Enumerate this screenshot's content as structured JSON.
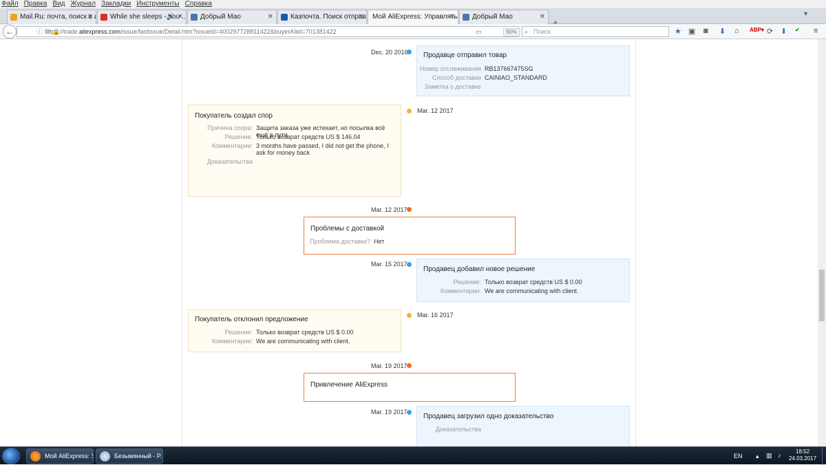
{
  "menu": [
    "Файл",
    "Правка",
    "Вид",
    "Журнал",
    "Закладки",
    "Инструменты",
    "Справка"
  ],
  "tabs": [
    {
      "label": "Mail.Ru: почта, поиск в ин...",
      "color": "#f0a020"
    },
    {
      "label": "While she sleeps - You ...",
      "color": "#d93025"
    },
    {
      "label": "Добрый Мао",
      "color": "#4a76a8"
    },
    {
      "label": "Казпочта. Поиск отправл...",
      "color": "#1e5aa8"
    },
    {
      "label": "Мой AliExpress: Управлять зак...",
      "color": "#e64a19"
    },
    {
      "label": "Добрый Мао",
      "color": "#4a76a8"
    }
  ],
  "address": {
    "prefix": "https://trade.",
    "domain": "aliexpress.com",
    "path": "/issue/fastissue/Detail.htm?issueId=400297728811422&buyerAliid=701381422",
    "zoom": "90%",
    "search_placeholder": "Поиск"
  },
  "timeline": [
    {
      "date": "Dec. 20 2016",
      "title": "Продавце отправил товар",
      "rows": [
        {
          "label": "Номер отслеживания",
          "value": "RB137667475SG"
        },
        {
          "label": "Способ доставки",
          "value": "CAINIAO_STANDARD"
        },
        {
          "label": "Заметка о доставке",
          "value": ""
        }
      ]
    },
    {
      "date": "Mar. 12 2017",
      "title": "Покупатель создал спор",
      "rows": [
        {
          "label": "Причина спора:",
          "value": "Защита заказа уже истекает, но посылка всё ещё в пути"
        },
        {
          "label": "Решение:",
          "value": "Только возврат средств US $ 146.04"
        },
        {
          "label": "Комментарии:",
          "value": "3 months have passed, I did not get the phone, I ask for money back"
        },
        {
          "label": "Доказательства",
          "value": ""
        }
      ]
    },
    {
      "date": "Mar. 12 2017",
      "title": "Проблемы с доставкой",
      "rows": [
        {
          "label": "Проблема доставки?",
          "value": "Нет"
        }
      ]
    },
    {
      "date": "Mar. 15 2017",
      "title": "Продавец добавил новое решение",
      "rows": [
        {
          "label": "Решение:",
          "value": "Только возврат средств US $ 0.00"
        },
        {
          "label": "Комментарии:",
          "value": "We are communicating with client."
        }
      ]
    },
    {
      "date": "Mar. 16 2017",
      "title": "Покупатель отклонил предложение",
      "rows": [
        {
          "label": "Решение:",
          "value": "Только возврат средств US $ 0.00"
        },
        {
          "label": "Комментарии:",
          "value": "We are communicating with client."
        }
      ]
    },
    {
      "date": "Mar. 19 2017",
      "title": "Привлечение AliExpress",
      "rows": []
    },
    {
      "date": "Mar. 19 2017",
      "title": "Продавец загрузил одно доказательство",
      "rows": [
        {
          "label": "Доказательства",
          "value": ""
        }
      ]
    }
  ],
  "taskbar": {
    "items": [
      "Мой AliExpress: У...",
      "Безымянный - P..."
    ],
    "lang": "EN",
    "time": "18:52",
    "date": "24.03.2017"
  },
  "colors": {
    "seller_dot": "#3aa0e8",
    "buyer_dot": "#f4b330",
    "system_dot": "#ef6c2a"
  }
}
